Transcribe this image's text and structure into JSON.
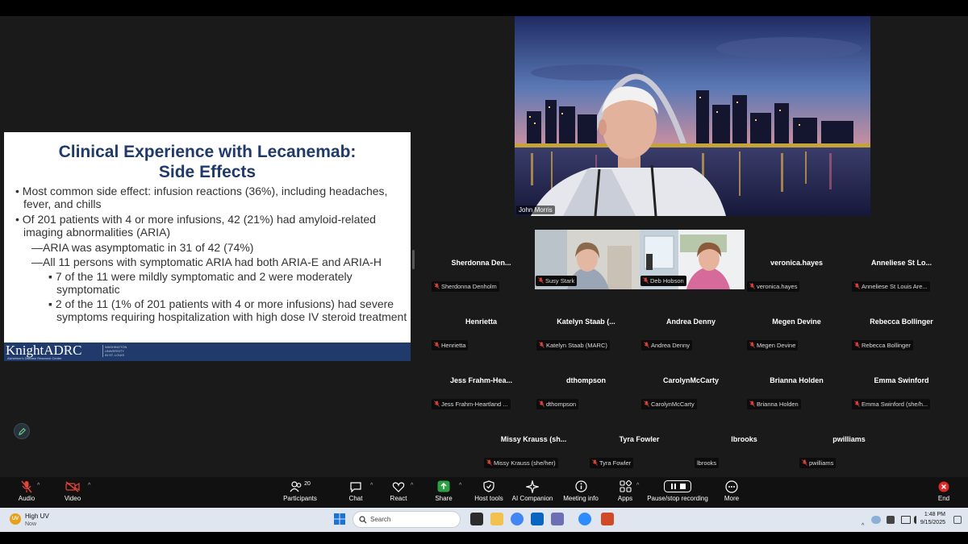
{
  "slide": {
    "title_line1": "Clinical Experience with Lecanemab:",
    "title_line2": "Side Effects",
    "b1": "• Most common side effect: infusion reactions (36%), including headaches, fever, and chills",
    "b2": "• Of 201 patients with 4 or  more infusions, 42 (21%) had amyloid-related imaging abnormalities (ARIA)",
    "b3": "—ARIA was asymptomatic in 31 of 42 (74%)",
    "b4": "—All 11 persons with symptomatic ARIA had both ARIA-E and ARIA-H",
    "b5": "▪ 7 of the 11 were mildly symptomatic and 2 were moderately symptomatic",
    "b6": "▪ 2 of the 11 (1% of 201 patients with 4 or more infusions) had severe symptoms requiring hospitalization with high dose IV steroid treatment",
    "logo": "KnightADRC",
    "logo_sub": "Alzheimer's Disease Research Center",
    "logo_wu": "WASHINGTON UNIVERSITY IN ST. LOUIS"
  },
  "speaker": {
    "name": "John Morris"
  },
  "video_tiles": [
    {
      "label": "Susy Stark"
    },
    {
      "label": "Deb Hobson"
    }
  ],
  "participants": [
    {
      "name": "Sherdonna  Den...",
      "label": "Sherdonna Denholm",
      "muted": true
    },
    {
      "name": "veronica.hayes",
      "label": "veronica.hayes",
      "muted": true
    },
    {
      "name": "Anneliese St Lo...",
      "label": "Anneliese St Louis Are...",
      "muted": true
    },
    {
      "name": "Henrietta",
      "label": "Henrietta",
      "muted": true
    },
    {
      "name": "Katelyn Staab (...",
      "label": "Katelyn Staab (MARC)",
      "muted": true
    },
    {
      "name": "Andrea Denny",
      "label": "Andrea Denny",
      "muted": true
    },
    {
      "name": "Megen Devine",
      "label": "Megen Devine",
      "muted": true
    },
    {
      "name": "Rebecca Bollinger",
      "label": "Rebecca Bollinger",
      "muted": true
    },
    {
      "name": "Jess  Frahm-Hea...",
      "label": "Jess Frahm-Heartland ...",
      "muted": true
    },
    {
      "name": "dthompson",
      "label": "dthompson",
      "muted": true
    },
    {
      "name": "CarolynMcCarty",
      "label": "CarolynMcCarty",
      "muted": true
    },
    {
      "name": "Brianna Holden",
      "label": "Brianna Holden",
      "muted": true
    },
    {
      "name": "Emma Swinford",
      "label": "Emma Swinford (she/h...",
      "muted": true
    },
    {
      "name": "Missy Krauss (sh...",
      "label": "Missy Krauss (she/her)",
      "muted": true
    },
    {
      "name": "Tyra Fowler",
      "label": "Tyra Fowler",
      "muted": true
    },
    {
      "name": "lbrooks",
      "label": "lbrooks",
      "muted": false
    },
    {
      "name": "pwilliams",
      "label": "pwilliams",
      "muted": true
    }
  ],
  "toolbar": {
    "audio": "Audio",
    "video": "Video",
    "participants": "Participants",
    "participants_count": "20",
    "chat": "Chat",
    "react": "React",
    "share": "Share",
    "host_tools": "Host tools",
    "ai_companion": "AI Companion",
    "meeting_info": "Meeting info",
    "apps": "Apps",
    "pause_recording": "Pause/stop recording",
    "more": "More",
    "end": "End"
  },
  "taskbar": {
    "weather_badge": "UV",
    "weather_title": "High UV",
    "weather_sub": "Now",
    "search_placeholder": "Search",
    "time": "1:48 PM",
    "date": "9/15/2025"
  },
  "colors": {
    "slide_title": "#1f3a6b",
    "muted_mic": "#e0453a",
    "share_green": "#2ea043",
    "end_red": "#e02828"
  }
}
